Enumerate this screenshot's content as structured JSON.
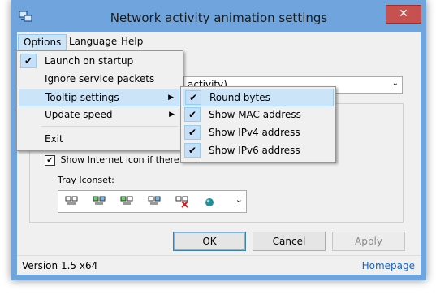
{
  "window": {
    "title": "Network activity animation settings",
    "close_glyph": "✕"
  },
  "menubar": {
    "options": "Options",
    "language": "Language",
    "help": "Help"
  },
  "options_menu": {
    "items": [
      {
        "label": "Launch on startup",
        "checked": true
      },
      {
        "label": "Ignore service packets",
        "checked": false
      },
      {
        "label": "Tooltip settings",
        "has_submenu": true
      },
      {
        "label": "Update speed",
        "has_submenu": true
      },
      {
        "label": "Exit"
      }
    ]
  },
  "tooltip_submenu": {
    "items": [
      {
        "label": "Round bytes",
        "checked": true
      },
      {
        "label": "Show MAC address",
        "checked": true
      },
      {
        "label": "Show IPv4 address",
        "checked": true
      },
      {
        "label": "Show IPv6 address",
        "checked": true
      }
    ]
  },
  "main": {
    "combo_value": "activity)",
    "internet_checkbox_label": "Show Internet icon if there is Int",
    "internet_checked": true,
    "tray_iconset_label": "Tray Iconset:"
  },
  "buttons": {
    "ok": "OK",
    "cancel": "Cancel",
    "apply": "Apply"
  },
  "status": {
    "version": "Version 1.5 x64",
    "homepage": "Homepage"
  },
  "glyphs": {
    "check": "✔",
    "arrow_right": "▶",
    "arrow_down": "⌄"
  },
  "colors": {
    "frame": "#6fa4dc",
    "highlight": "#cce4f7",
    "link": "#1c63c4",
    "close": "#c75050"
  }
}
